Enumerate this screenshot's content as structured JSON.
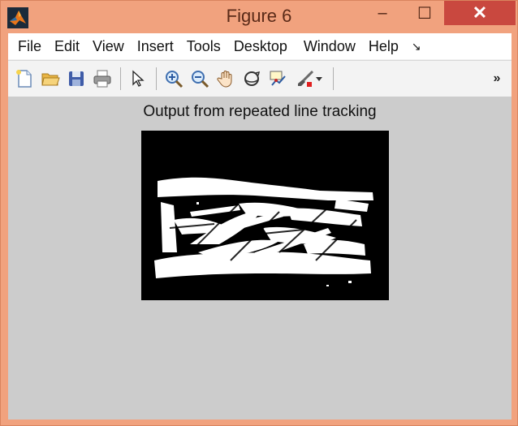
{
  "window": {
    "title": "Figure 6"
  },
  "controls": {
    "minimize": "–",
    "maximize": "☐",
    "close": "✕"
  },
  "menu": {
    "items": [
      "File",
      "Edit",
      "View",
      "Insert",
      "Tools",
      "Desktop",
      "Window",
      "Help"
    ],
    "overflow_glyph": "↘"
  },
  "toolbar": {
    "buttons": [
      "new-figure-icon",
      "open-file-icon",
      "save-icon",
      "print-icon",
      "select-arrow-icon",
      "zoom-in-icon",
      "zoom-out-icon",
      "pan-hand-icon",
      "rotate-3d-icon",
      "data-cursor-icon",
      "brush-icon",
      "brush-dropdown-icon"
    ],
    "overflow_glyph": "»"
  },
  "figure": {
    "title": "Output from repeated line tracking"
  },
  "colors": {
    "title_bar": "#f1a27e",
    "close_button": "#c9483f",
    "figure_background": "#cccccc",
    "image_background": "#000000",
    "image_foreground": "#ffffff"
  }
}
